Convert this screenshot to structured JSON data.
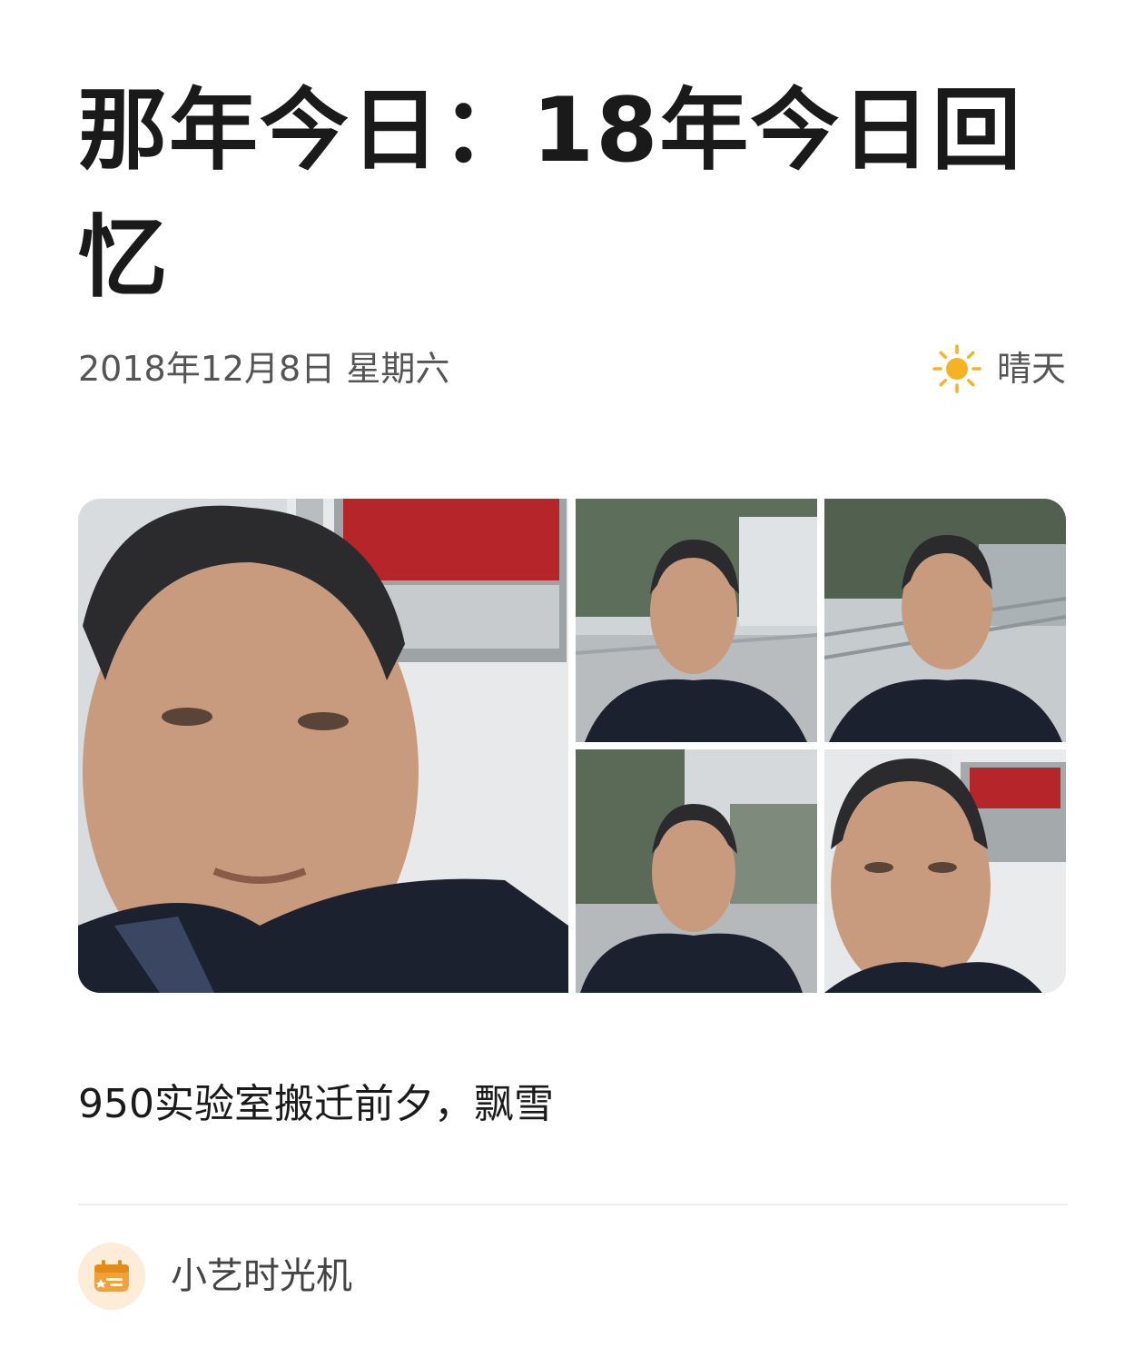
{
  "article": {
    "title": "那年今日：18年今日回忆",
    "date": "2018年12月8日 星期六",
    "weather": {
      "icon": "sun-icon",
      "label": "晴天",
      "color": "#f5b324"
    },
    "gallery": {
      "photos": [
        {
          "name": "photo-main",
          "description_icon": "photo"
        },
        {
          "name": "photo-2",
          "description_icon": "photo"
        },
        {
          "name": "photo-3",
          "description_icon": "photo"
        },
        {
          "name": "photo-4",
          "description_icon": "photo"
        },
        {
          "name": "photo-5",
          "description_icon": "photo"
        }
      ]
    },
    "caption": "950实验室搬迁前夕，飘雪"
  },
  "source": {
    "icon": "calendar-icon",
    "label": "小艺时光机",
    "accent_color": "#f0a13a"
  }
}
